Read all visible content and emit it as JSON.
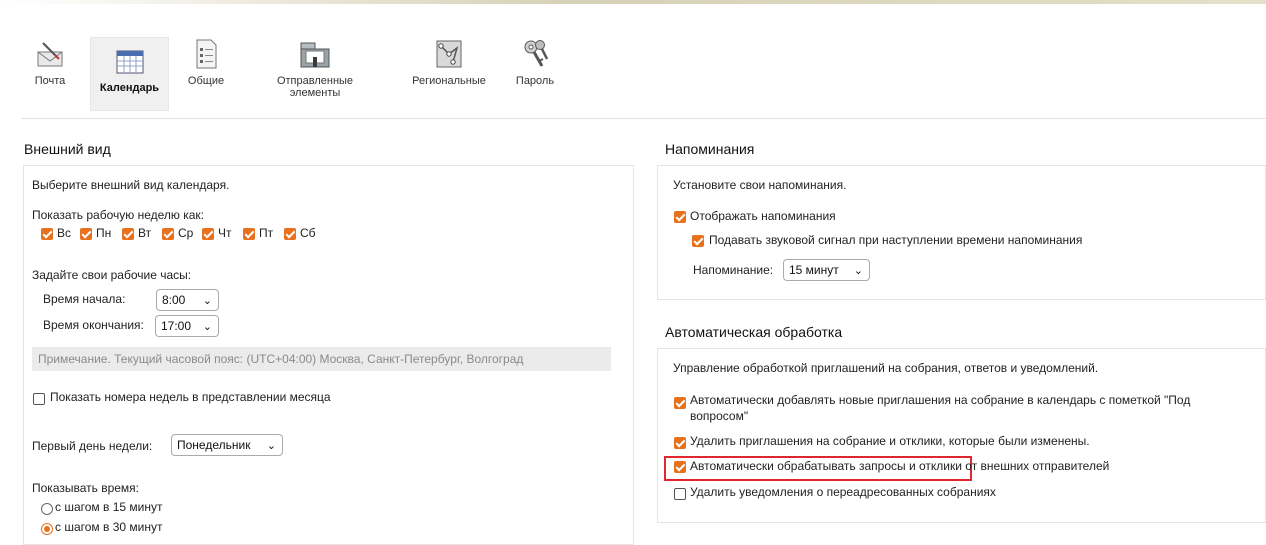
{
  "toolbar": {
    "items": [
      {
        "label": "Почта",
        "icon": "mail-icon"
      },
      {
        "label": "Календарь",
        "icon": "calendar-icon"
      },
      {
        "label": "Общие",
        "icon": "general-settings-icon"
      },
      {
        "label": "Отправленные элементы",
        "label_line1": "Отправленные",
        "label_line2": "элементы",
        "icon": "sent-items-icon"
      },
      {
        "label": "Региональные",
        "icon": "regional-icon"
      },
      {
        "label": "Пароль",
        "icon": "password-keys-icon"
      }
    ],
    "active": "Календарь"
  },
  "appearance": {
    "title": "Внешний вид",
    "intro": "Выберите внешний вид календаря.",
    "workweek_label": "Показать рабочую неделю как:",
    "days": [
      {
        "label": "Вс",
        "checked": true
      },
      {
        "label": "Пн",
        "checked": true
      },
      {
        "label": "Вт",
        "checked": true
      },
      {
        "label": "Ср",
        "checked": true
      },
      {
        "label": "Чт",
        "checked": true
      },
      {
        "label": "Пт",
        "checked": true
      },
      {
        "label": "Сб",
        "checked": true
      }
    ],
    "hours_label": "Задайте свои рабочие часы:",
    "start_label": "Время начала:",
    "start_value": "8:00",
    "end_label": "Время окончания:",
    "end_value": "17:00",
    "note": "Примечание. Текущий часовой пояс: (UTC+04:00) Москва, Санкт-Петербург, Волгоград",
    "week_numbers_label": "Показать номера недель в представлении месяца",
    "week_numbers_checked": false,
    "first_day_label": "Первый день недели:",
    "first_day_value": "Понедельник",
    "show_time_label": "Показывать время:",
    "time_options": [
      {
        "label": "с шагом в 15 минут",
        "selected": false
      },
      {
        "label": "с шагом в 30 минут",
        "selected": true
      }
    ]
  },
  "reminders": {
    "title": "Напоминания",
    "intro": "Установите свои напоминания.",
    "show_label": "Отображать напоминания",
    "show_checked": true,
    "sound_label": "Подавать звуковой сигнал при наступлении времени напоминания",
    "sound_checked": true,
    "reminder_label": "Напоминание:",
    "reminder_value": "15 минут"
  },
  "auto": {
    "title": "Автоматическая обработка",
    "intro": "Управление обработкой приглашений на собрания, ответов и уведомлений.",
    "options": [
      {
        "line1": "Автоматически добавлять новые приглашения на собрание в календарь с пометкой \"Под",
        "line2": "вопросом\"",
        "checked": true
      },
      {
        "line1": "Удалить приглашения на собрание и отклики, которые были изменены.",
        "checked": true
      },
      {
        "line1": "Автоматически обрабатывать запросы и отклики от внешних отправителей",
        "checked": true
      },
      {
        "line1": "Удалить уведомления о переадресованных собраниях",
        "checked": false
      }
    ]
  },
  "colors": {
    "accent": "#e8711e",
    "highlight": "#e0262e"
  }
}
